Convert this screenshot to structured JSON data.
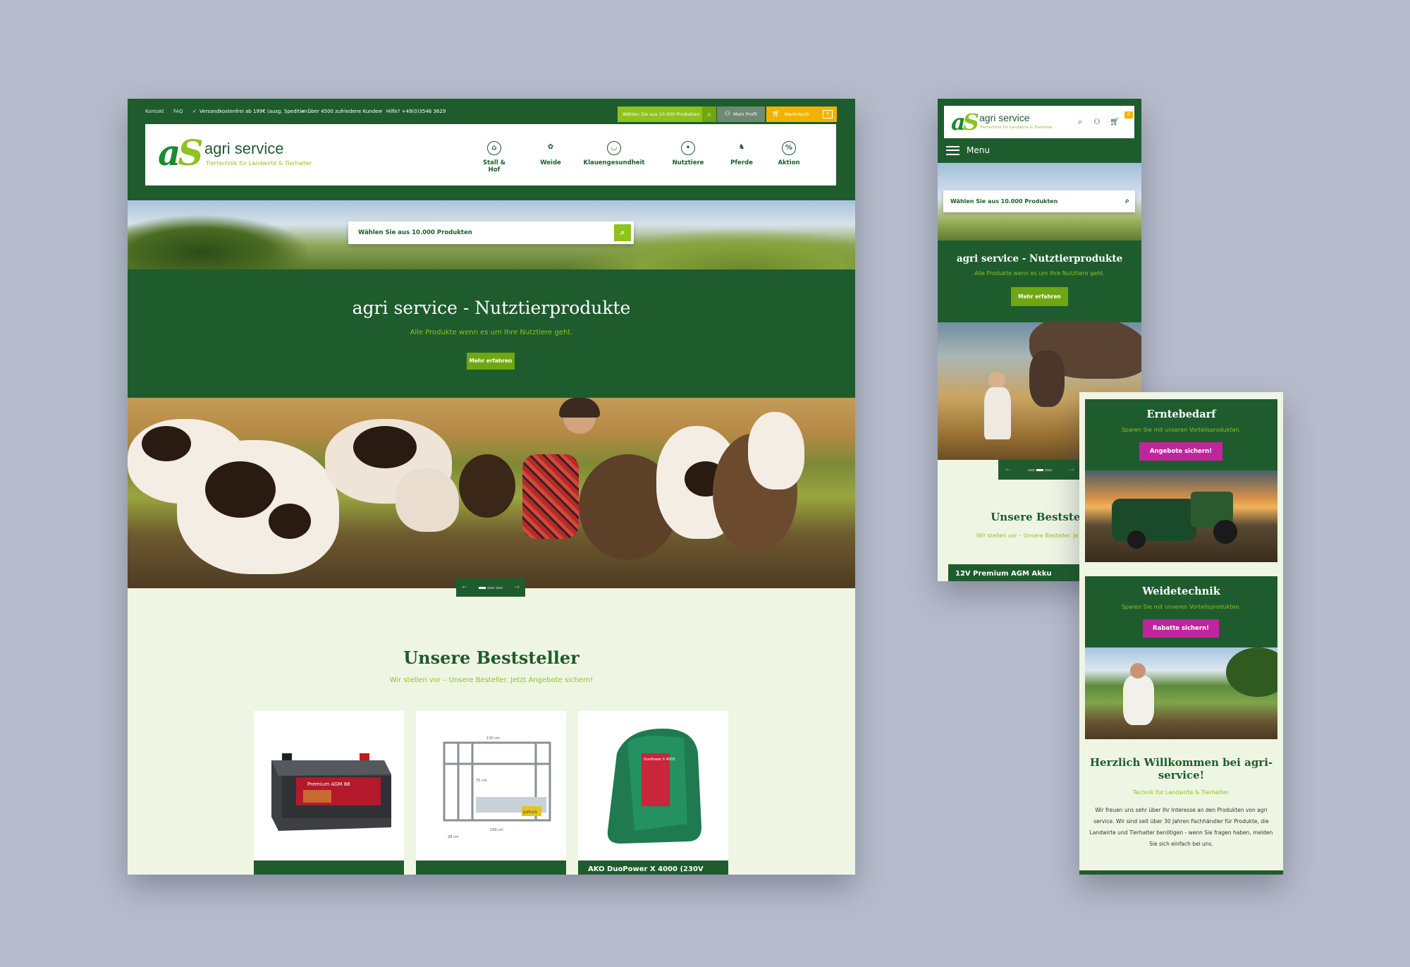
{
  "colors": {
    "dark_green": "#1e5c2e",
    "lime": "#8dc21f",
    "yellow": "#f0b400",
    "magenta": "#c0259c",
    "background": "#b6bccb"
  },
  "desktop": {
    "topbar": {
      "kontakt": "Kontakt",
      "faq": "FAQ",
      "usp1": "Versandkostenfrei ab 199€ (ausg. Spedition)",
      "usp2": "über 4500 zufriedene Kunden",
      "usp3": "Hilfe? +49(0)3546 3629",
      "search_placeholder": "Wählen Sie aus 10.000 Produkten",
      "profile": "Mein Profil",
      "cart": "Warenkorb",
      "cart_count": "0"
    },
    "logo_mark_a": "a",
    "logo_mark_s": "S",
    "brand": "agri service",
    "tagline": "Tiertechnik für Landwirte & Tierhalter",
    "nav": [
      {
        "label": "Stall & Hof",
        "icon": "barn-icon"
      },
      {
        "label": "Weide",
        "icon": "grass-icon"
      },
      {
        "label": "Klauengesundheit",
        "icon": "hoof-icon"
      },
      {
        "label": "Nutztiere",
        "icon": "pig-icon"
      },
      {
        "label": "Pferde",
        "icon": "horse-icon"
      },
      {
        "label": "Aktion",
        "icon": "percent-icon"
      }
    ],
    "hero_search_placeholder": "Wählen Sie aus 10.000 Produkten",
    "hero_title": "agri service - Nutztierprodukte",
    "hero_subtitle": "Alle Produkte wenn es um Ihre Nutztiere geht.",
    "hero_button": "Mehr erfahren",
    "slider": {
      "prev": "←",
      "next": "→"
    },
    "bestseller_title": "Unsere Beststeller",
    "bestseller_subtitle": "Wir stellen vor – Unsere Besteller. Jetzt Angebote sichern!",
    "products": [
      {
        "name": "",
        "image_label": "Premium AGM 88"
      },
      {
        "name": "",
        "image_label": "patura"
      },
      {
        "name": "AKO DuoPower X 4000 (230V",
        "image_label": "DuoPower X 4000"
      }
    ],
    "dimension_labels": [
      "130 cm",
      "190 cm",
      "75 cm",
      "28 cm"
    ]
  },
  "mobile1": {
    "brand": "agri service",
    "tagline": "Tiertechnik für Landwirte & Tierhalter",
    "cart_count": "0",
    "menu": "Menu",
    "search_placeholder": "Wählen Sie aus 10.000 Produkten",
    "hero_title": "agri service - Nutztierprodukte",
    "hero_subtitle": "Alle Produkte wenn es um Ihre Nutztiere geht.",
    "hero_button": "Mehr erfahren",
    "bestseller_title": "Unsere Beststell",
    "bestseller_subtitle": "Wir stellen vor – Unsere Besteller. Je sichern!",
    "product_name": "12V Premium AGM Akku"
  },
  "mobile2": {
    "promo1": {
      "title": "Erntebedarf",
      "subtitle": "Sparen Sie mit unseren Vorteilsprodukten.",
      "button": "Angebote sichern!"
    },
    "promo2": {
      "title": "Weidetechnik",
      "subtitle": "Sparen Sie mit unseren Vorteilsprodukten.",
      "button": "Rabatte sichern!"
    },
    "welcome_title": "Herzlich Willkommen bei agri-service!",
    "welcome_sub": "Technik für Landwirte & Tierhalter.",
    "welcome_text": "Wir freuen uns sehr über Ihr Interesse an den Produkten von agri service. Wir sind seit über 30 Jahren Fachhändler für Produkte, die Landwirte und Tierhalter benötigen - wenn Sie fragen haben, melden Sie sich einfach bei uns."
  }
}
